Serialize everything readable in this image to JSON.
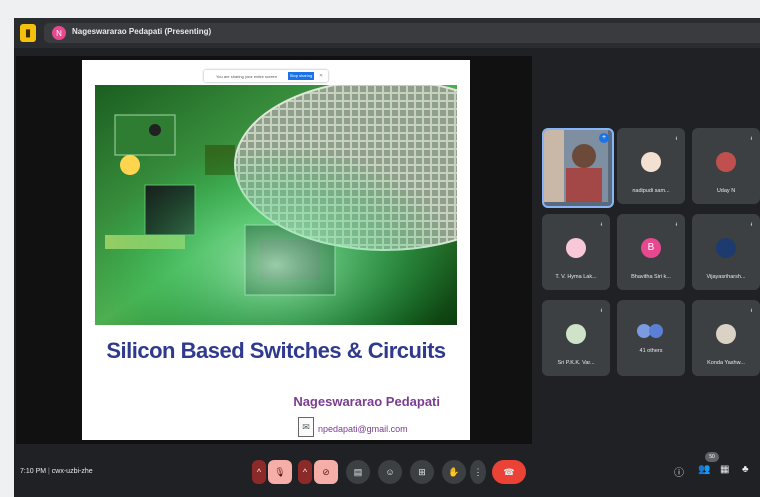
{
  "topbar": {
    "presenter_label": "Nageswararao Pedapati (Presenting)",
    "presenter_initial": "N"
  },
  "slide": {
    "title": "Silicon Based Switches & Circuits",
    "author": "Nageswararao Pedapati",
    "email": "npedapati@gmail.com",
    "share_notice": "You are sharing your entire screen",
    "share_stop": "Stop sharing",
    "share_hide": "Hide"
  },
  "participants": [
    {
      "name": "Nageswararao Pedapati",
      "self": true
    },
    {
      "name": "nadipudi sam..."
    },
    {
      "name": "Uday N"
    },
    {
      "name": "T. V. Hyma Lak..."
    },
    {
      "name": "Bhavitha Siri k...",
      "initial": "B",
      "color": "#e8488f"
    },
    {
      "name": "Vijayasriharsh..."
    },
    {
      "name": "Sri P.K.K. Var..."
    },
    {
      "name": "41 others"
    },
    {
      "name": "Konda Yashw..."
    }
  ],
  "controls": {
    "time": "7:10 PM",
    "meeting_code": "cwx-uzbi-zhe",
    "people_count": "50"
  },
  "colors": {
    "accent": "#1a73e8",
    "leave": "#ea4335",
    "off": "#f6aea9"
  }
}
